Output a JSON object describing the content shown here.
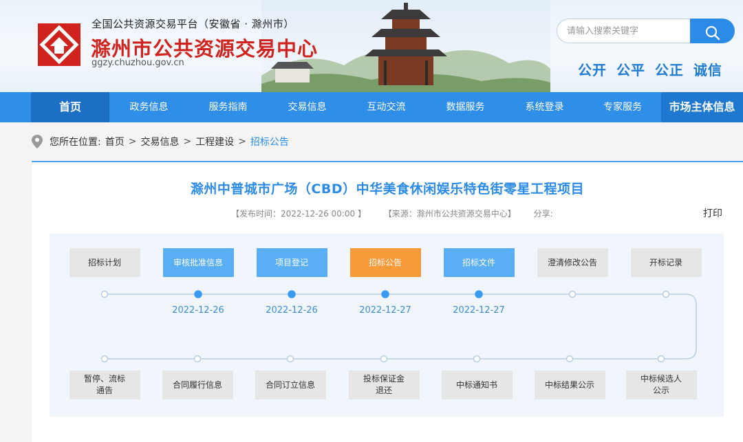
{
  "header": {
    "platform_sub": "全国公共资源交易平台（安徽省 · 滁州市）",
    "site_name": "滁州市公共资源交易中心",
    "url": "ggzy.chuzhou.gov.cn",
    "search_placeholder": "请输入搜索关键字",
    "slogan": "公开 公平 公正 诚信"
  },
  "nav": {
    "items": [
      "首页",
      "政务信息",
      "服务指南",
      "交易信息",
      "互动交流",
      "数据服务",
      "系统登录",
      "专家服务",
      "市场主体信息"
    ]
  },
  "breadcrumb": {
    "prefix": "您所在位置:",
    "items": [
      "首页",
      "交易信息",
      "工程建设",
      "招标公告"
    ],
    "sep": ">"
  },
  "article": {
    "title": "滁州中普城市广场（CBD）中华美食休闲娱乐特色街零星工程项目",
    "publish_time": "【发布时间：2022-12-26 00:00 】",
    "source": "【来源：滁州市公共资源交易中心】",
    "share": "分享:",
    "print": "打印"
  },
  "flow": {
    "top_steps": [
      {
        "label": "招标计划",
        "state": "none",
        "date": ""
      },
      {
        "label": "审核批准信息",
        "state": "done",
        "date": "2022-12-26"
      },
      {
        "label": "项目登记",
        "state": "done",
        "date": "2022-12-26"
      },
      {
        "label": "招标公告",
        "state": "current",
        "date": "2022-12-27"
      },
      {
        "label": "招标文件",
        "state": "done",
        "date": "2022-12-27"
      },
      {
        "label": "澄清修改公告",
        "state": "none",
        "date": ""
      },
      {
        "label": "开标记录",
        "state": "none",
        "date": ""
      }
    ],
    "bottom_steps": [
      "暂停、流标\n通告",
      "合同履行信息",
      "合同订立信息",
      "投标保证金\n退还",
      "中标通知书",
      "中标结果公示",
      "中标候选人\n公示"
    ]
  },
  "section_heading": "",
  "colors": {
    "accent": "#2b8be6",
    "nav": "#2e8ee8",
    "current": "#f79a3a",
    "done": "#5aaef3",
    "brand_red": "#d0231d"
  },
  "icons": {
    "logo": "house-logo-icon",
    "search": "search-icon",
    "pin": "location-pin-icon"
  }
}
